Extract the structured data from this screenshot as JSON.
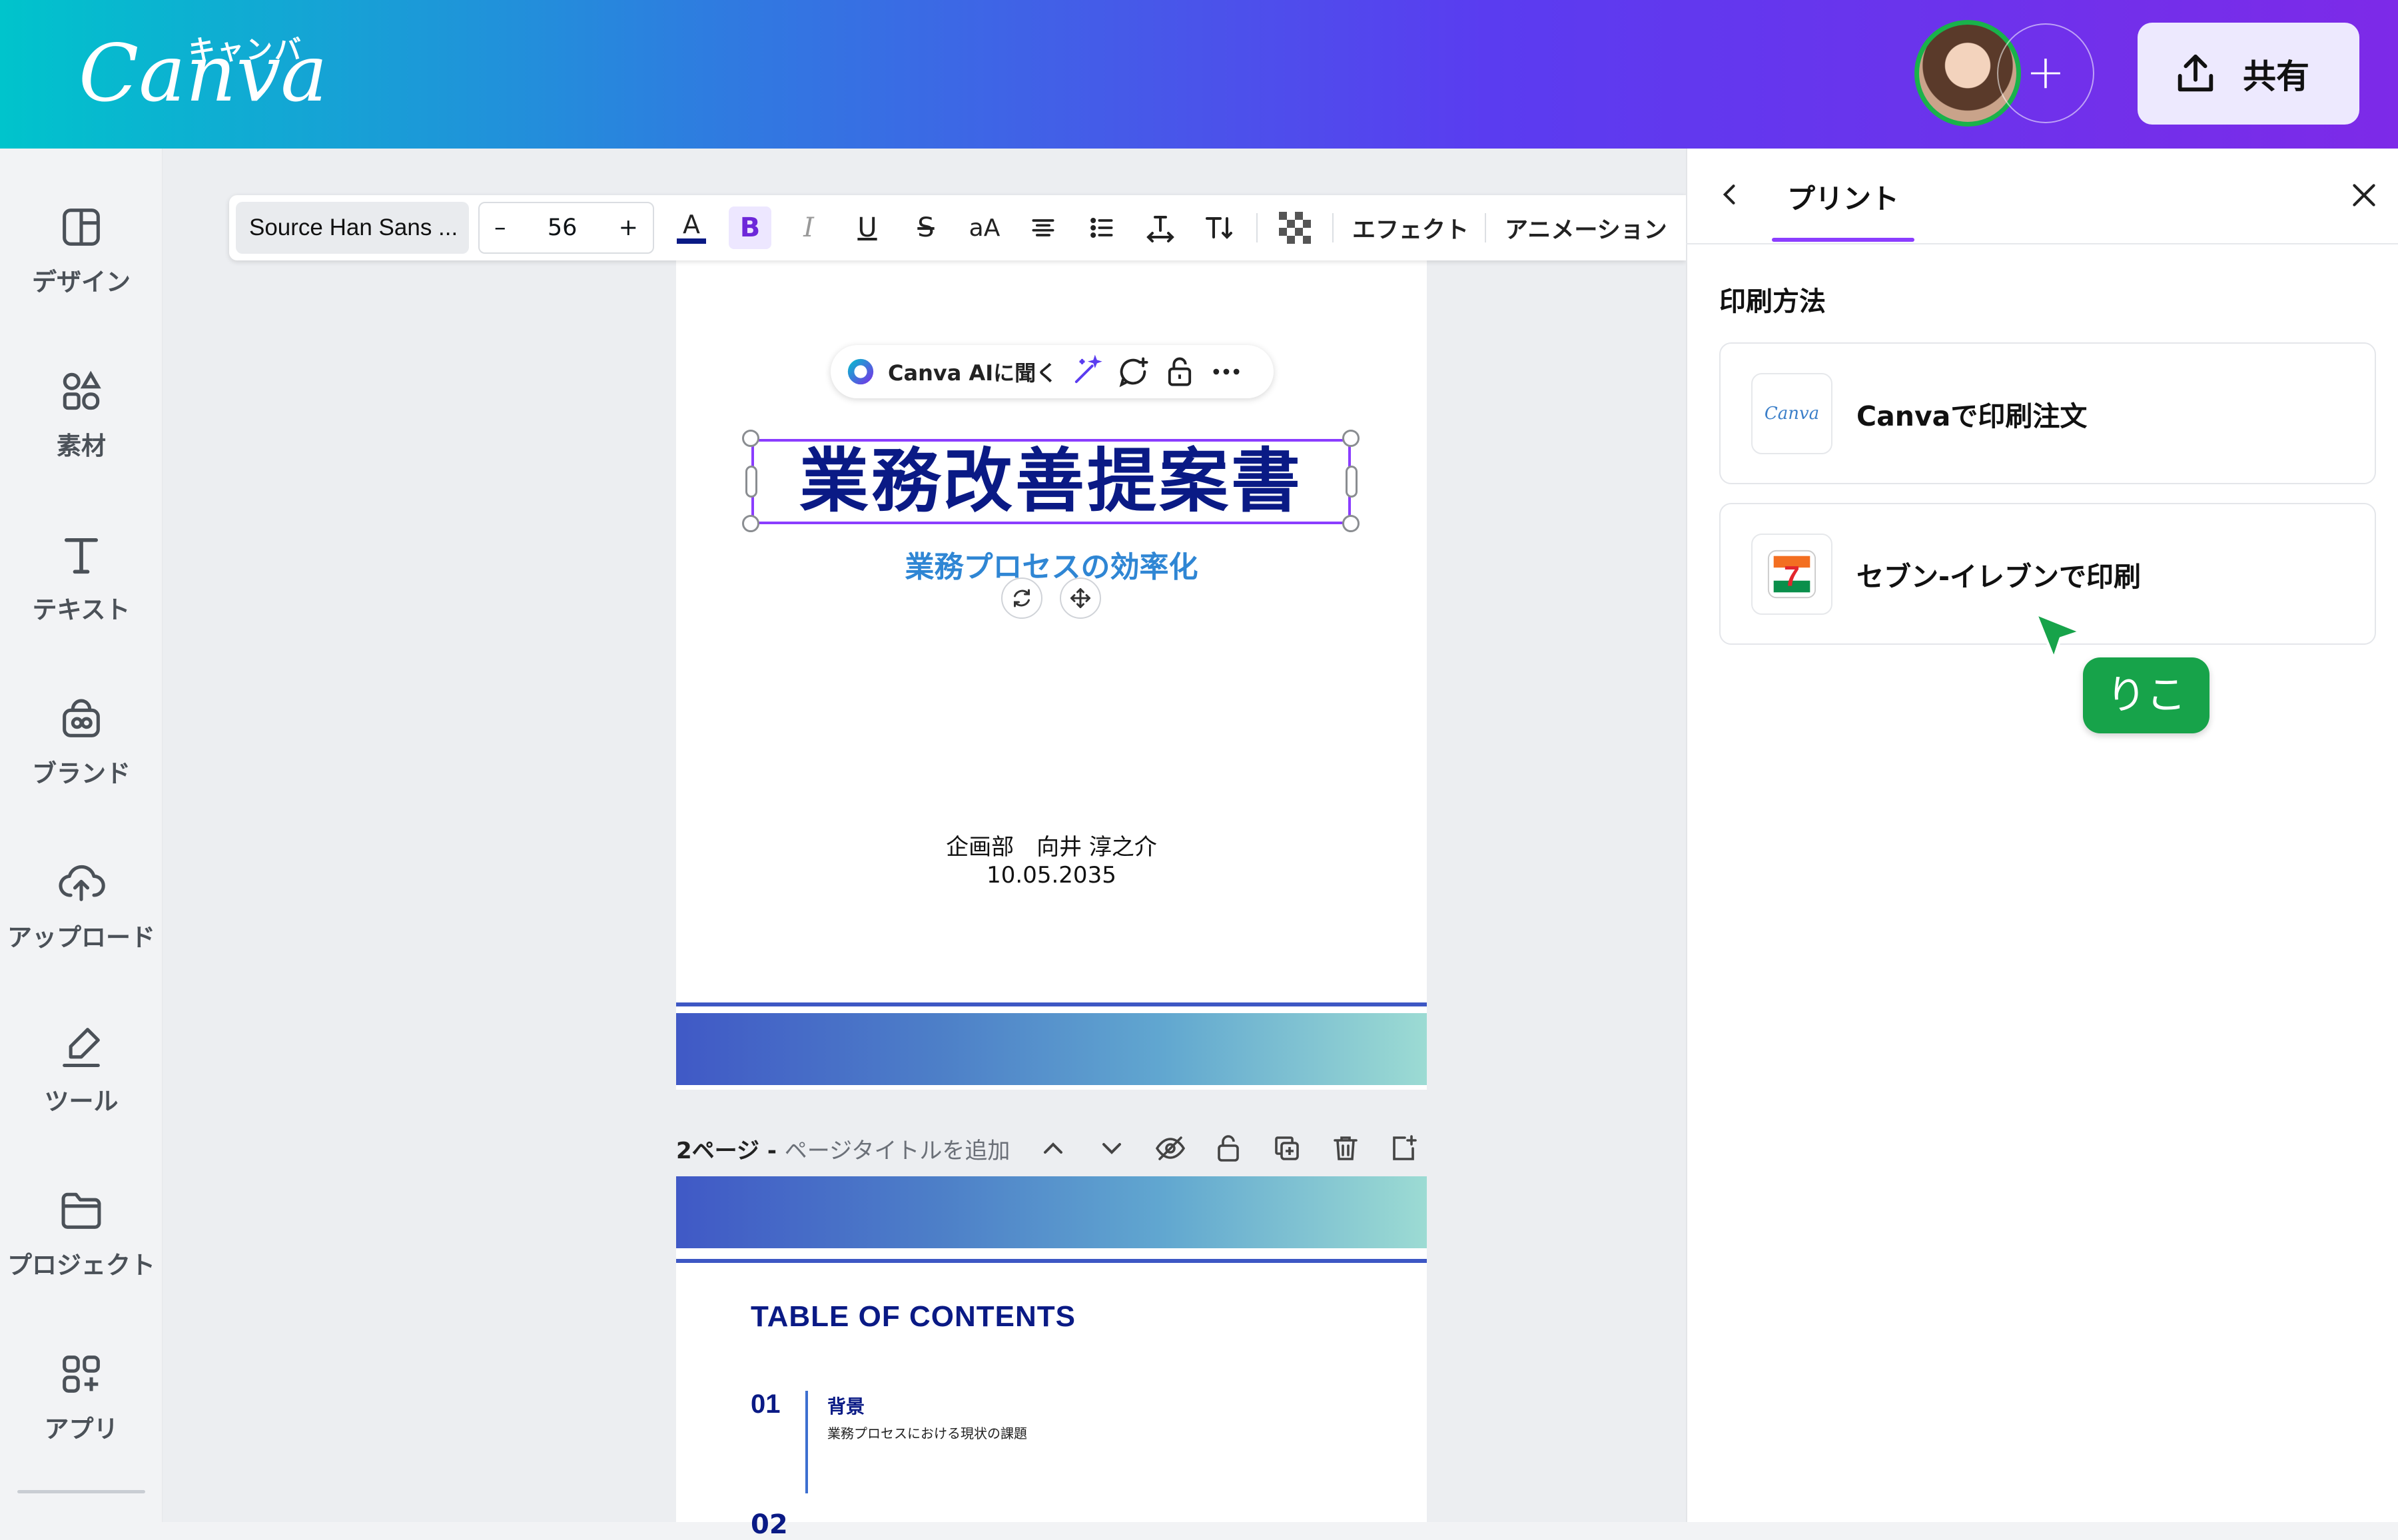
{
  "header": {
    "logo_kana": "キャンバ",
    "logo_word": "Canva",
    "share_label": "共有"
  },
  "sidebar": {
    "items": [
      {
        "label": "デザイン",
        "icon": "design-icon"
      },
      {
        "label": "素材",
        "icon": "elements-icon"
      },
      {
        "label": "テキスト",
        "icon": "text-icon"
      },
      {
        "label": "ブランド",
        "icon": "brand-icon"
      },
      {
        "label": "アップロード",
        "icon": "upload-cloud-icon"
      },
      {
        "label": "ツール",
        "icon": "draw-tool-icon"
      },
      {
        "label": "プロジェクト",
        "icon": "folder-icon"
      },
      {
        "label": "アプリ",
        "icon": "apps-icon"
      }
    ]
  },
  "toolbar": {
    "font_name": "Source Han Sans ...",
    "minus": "–",
    "font_size": "56",
    "plus": "+",
    "text_color_glyph": "A",
    "bold_glyph": "B",
    "italic_glyph": "I",
    "underline_glyph": "U",
    "strike_glyph": "S",
    "case_glyph": "aA",
    "effects_label": "エフェクト",
    "animation_label": "アニメーション",
    "accent_color": "#8b3dff"
  },
  "ai_bar": {
    "label": "Canva AIに聞く"
  },
  "page1": {
    "title": "業務改善提案書",
    "subtitle": "業務プロセスの効率化",
    "author": "企画部　向井 淳之介",
    "date": "10.05.2035"
  },
  "page2": {
    "label_num": "2ページ - ",
    "label_sub": "ページタイトルを追加",
    "toc_title": "TABLE OF CONTENTS",
    "toc_items": [
      {
        "num": "01",
        "head": "背景",
        "desc": "業務プロセスにおける現状の課題"
      },
      {
        "num": "02"
      }
    ]
  },
  "panel": {
    "tab_title": "プリント",
    "section_title": "印刷方法",
    "options": [
      {
        "label": "Canvaで印刷注文",
        "logo_text": "Canva"
      },
      {
        "label": "セブン-イレブンで印刷",
        "logo_text": "7"
      }
    ],
    "collaborator_cursor": "りこ",
    "cursor_color": "#17a34a"
  }
}
